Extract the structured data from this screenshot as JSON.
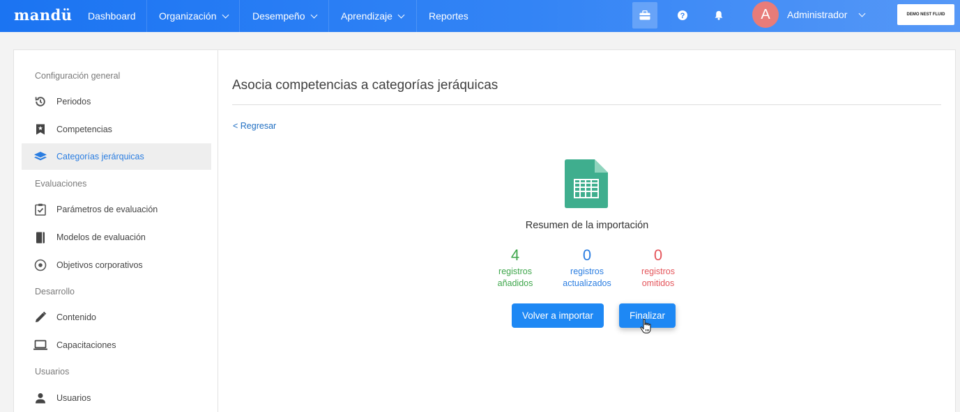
{
  "header": {
    "logo": "mandü",
    "nav": [
      {
        "label": "Dashboard"
      },
      {
        "label": "Organización"
      },
      {
        "label": "Desempeño"
      },
      {
        "label": "Aprendizaje"
      },
      {
        "label": "Reportes"
      }
    ],
    "user": {
      "initial": "A",
      "name": "Administrador"
    },
    "company_badge": "DEMO NEST FLUID",
    "icons": [
      "briefcase-icon",
      "help-icon",
      "bell-icon"
    ]
  },
  "sidebar": {
    "sections": [
      {
        "title": "Configuración general",
        "items": [
          {
            "label": "Periodos",
            "icon": "history-icon"
          },
          {
            "label": "Competencias",
            "icon": "bookmark-icon"
          },
          {
            "label": "Categorías jerárquicas",
            "icon": "layers-icon",
            "active": true
          }
        ]
      },
      {
        "title": "Evaluaciones",
        "items": [
          {
            "label": "Parámetros de evaluación",
            "icon": "checklist-icon"
          },
          {
            "label": "Modelos de evaluación",
            "icon": "book-icon"
          },
          {
            "label": "Objetivos corporativos",
            "icon": "target-icon"
          }
        ]
      },
      {
        "title": "Desarrollo",
        "items": [
          {
            "label": "Contenido",
            "icon": "pencil-icon"
          },
          {
            "label": "Capacitaciones",
            "icon": "laptop-icon"
          }
        ]
      },
      {
        "title": "Usuarios",
        "items": [
          {
            "label": "Usuarios",
            "icon": "person-icon"
          }
        ]
      }
    ]
  },
  "main": {
    "title": "Asocia competencias a categorías jeráquicas",
    "back_link": "< Regresar",
    "summary_title": "Resumen de la importación",
    "stats": [
      {
        "value": "4",
        "line1": "registros",
        "line2": "añadidos",
        "color": "#3ea64b"
      },
      {
        "value": "0",
        "line1": "registros",
        "line2": "actualizados",
        "color": "#2a7de1"
      },
      {
        "value": "0",
        "line1": "registros",
        "line2": "omitidos",
        "color": "#e4555b"
      }
    ],
    "buttons": {
      "reimport": "Volver a importar",
      "finish": "Finalizar"
    }
  },
  "colors": {
    "accent": "#1e88f4",
    "nav_gradient_start": "#1b74f2",
    "spreadsheet_icon": "#3fae8e"
  }
}
